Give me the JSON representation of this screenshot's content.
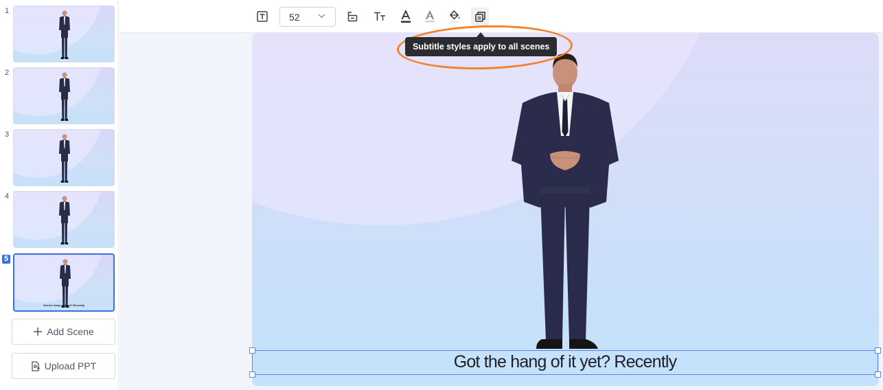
{
  "sidebar": {
    "scenes": [
      {
        "number": "1",
        "caption": ""
      },
      {
        "number": "2",
        "caption": ""
      },
      {
        "number": "3",
        "caption": ""
      },
      {
        "number": "4",
        "caption": ""
      },
      {
        "number": "5",
        "caption": "Got the hang of it yet? Recently"
      }
    ],
    "active_scene": "5",
    "add_scene_label": "Add Scene",
    "upload_ppt_label": "Upload PPT"
  },
  "toolbar": {
    "font_size": "52",
    "icons": [
      "text-box-icon",
      "text-position-icon",
      "text-size-icon",
      "font-color-icon",
      "text-outline-icon",
      "fill-color-icon",
      "apply-all-icon"
    ]
  },
  "tooltip": {
    "text": "Subtitle styles apply to all scenes"
  },
  "canvas": {
    "subtitle": "Got the hang of it yet? Recently"
  },
  "colors": {
    "accent": "#3b6fe0",
    "annotation": "#f2832a",
    "tooltip_bg": "#2b2c30"
  }
}
